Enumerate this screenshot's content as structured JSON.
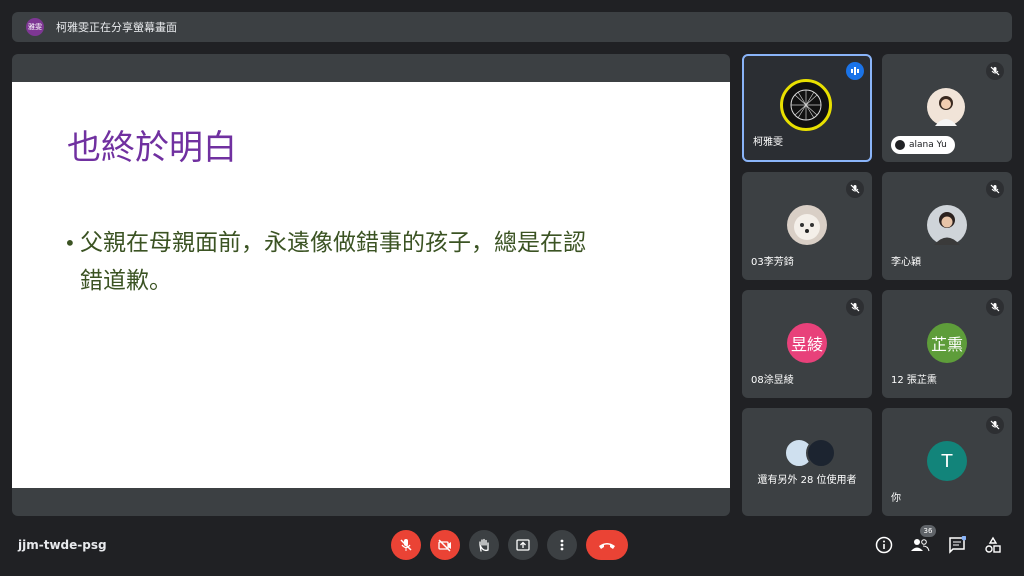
{
  "banner": {
    "avatar_text": "雅雯",
    "text": "柯雅雯正在分享螢幕畫面"
  },
  "slide": {
    "title": "也終於明白",
    "bullet_mark": "•",
    "bullet_line1": "父親在母親面前，永遠像做錯事的孩子，總是在認",
    "bullet_line2": "錯道歉。"
  },
  "participants": [
    {
      "name": "柯雅雯",
      "status": "speaking"
    },
    {
      "name": "alana Yu",
      "status": "muted"
    },
    {
      "name": "03李芳錡",
      "status": "muted"
    },
    {
      "name": "李心穎",
      "status": "muted"
    },
    {
      "name": "08涂昱綾",
      "status": "muted",
      "initials": "昱綾",
      "color": "#e8417a"
    },
    {
      "name": "12 張芷熏",
      "status": "muted",
      "initials": "芷熏",
      "color": "#5e9d3a"
    },
    {
      "name": "還有另外 28 位使用者",
      "status": "group"
    },
    {
      "name": "你",
      "status": "muted",
      "initials": "T",
      "color": "#12847a"
    }
  ],
  "footer": {
    "meeting_code": "jjm-twde-psg",
    "participant_count": "36"
  },
  "colors": {
    "end_call": "#ea4335",
    "accent": "#8ab4f8",
    "slide_title": "#7030a0",
    "slide_text": "#3b5323"
  }
}
